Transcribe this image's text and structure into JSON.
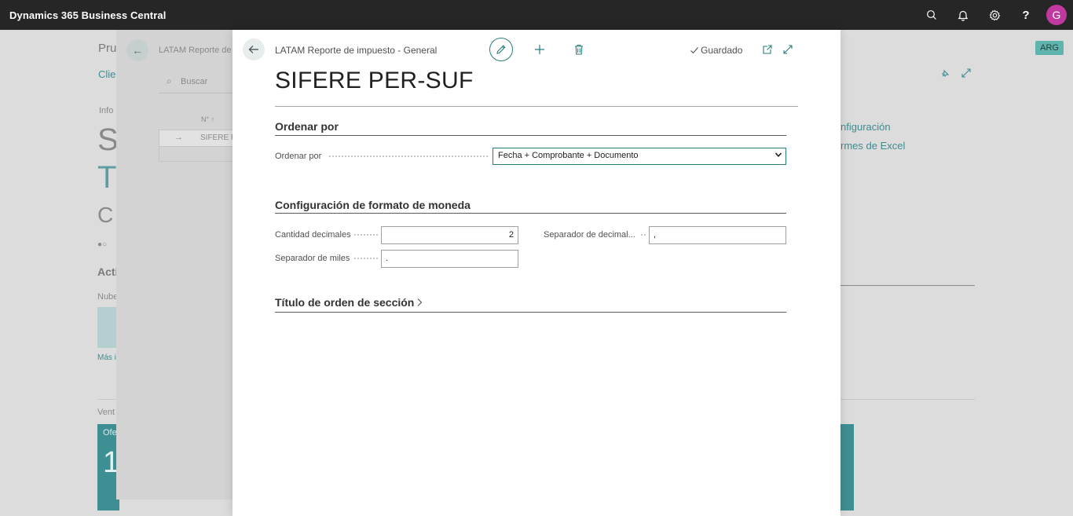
{
  "topbar": {
    "brand": "Dynamics 365 Business Central",
    "avatar_initial": "G",
    "help_glyph": "?",
    "icons": [
      "search-icon",
      "bell-icon",
      "gear-icon",
      "help-icon"
    ]
  },
  "background": {
    "badge": "ARG",
    "texts": {
      "pru": "Pru",
      "clie": "Clie",
      "info": "Info",
      "s": "S",
      "t": "T",
      "c": "C",
      "acti": "Acti",
      "nube": "Nube",
      "mas": "Más i",
      "vent": "Vent",
      "ofe": "Ofe",
      "one": "1",
      "config": "nfiguración",
      "excel": "rmes de Excel",
      "crumb": "LATAM Reporte de",
      "buscar": "Buscar",
      "n_col": "N° ↑",
      "row_name": "SIFERE P"
    }
  },
  "modal": {
    "breadcrumb": "LATAM Reporte de impuesto - General",
    "saved": "Guardado",
    "title": "SIFERE PER-SUF",
    "sections": {
      "order": {
        "heading": "Ordenar por",
        "field_label": "Ordenar por",
        "value": "Fecha + Comprobante + Documento"
      },
      "currency": {
        "heading": "Configuración de formato de moneda",
        "decimals_label": "Cantidad decimales",
        "decimals_value": "2",
        "decimal_sep_label": "Separador de decimal...",
        "decimal_sep_value": ",",
        "thousands_label": "Separador de miles",
        "thousands_value": "."
      },
      "section_title": {
        "heading": "Título de orden de sección"
      }
    }
  },
  "colors": {
    "accent": "#2a7d7b",
    "topbar": "#262626",
    "avatar": "#c0399f",
    "tile": "#3e8f94"
  }
}
